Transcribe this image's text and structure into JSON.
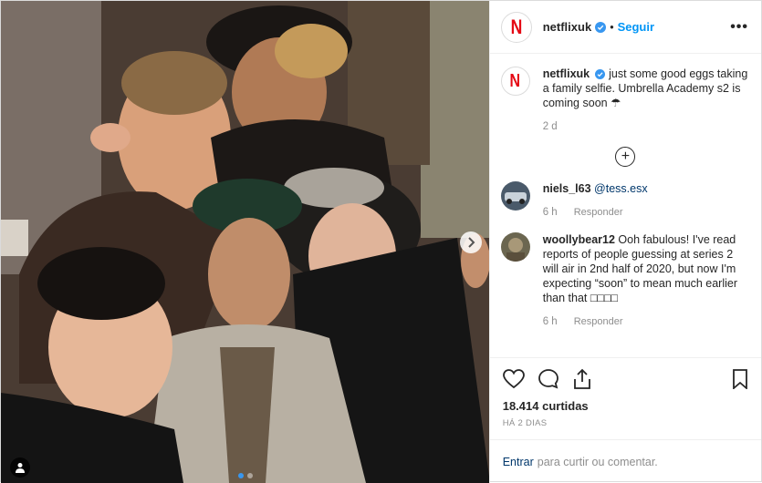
{
  "post": {
    "username": "netflixuk",
    "follow_label": "Seguir",
    "more_label": "•••",
    "logo_letter": "N",
    "caption": "just some good eggs taking a family selfie. Umbrella Academy s2 is coming soon ☂",
    "caption_time": "2 d",
    "load_more_label": "+",
    "comments": [
      {
        "user": "niels_l63",
        "text": "@tess.esx",
        "time": "6 h",
        "reply_label": "Responder"
      },
      {
        "user": "woollybear12",
        "text": "Ooh fabulous! I've read reports of people guessing at series 2 will air in 2nd half of 2020, but now I'm expecting “soon” to mean much earlier than that □□□□",
        "time": "6 h",
        "reply_label": "Responder"
      }
    ],
    "likes": "18.414 curtidas",
    "date": "HÁ 2 DIAS",
    "add_comment_link": "Entrar",
    "add_comment_text": "para curtir ou comentar."
  },
  "colors": {
    "accent": "#0095f6",
    "netflix_red": "#e50914",
    "muted": "#8e8e8e"
  }
}
